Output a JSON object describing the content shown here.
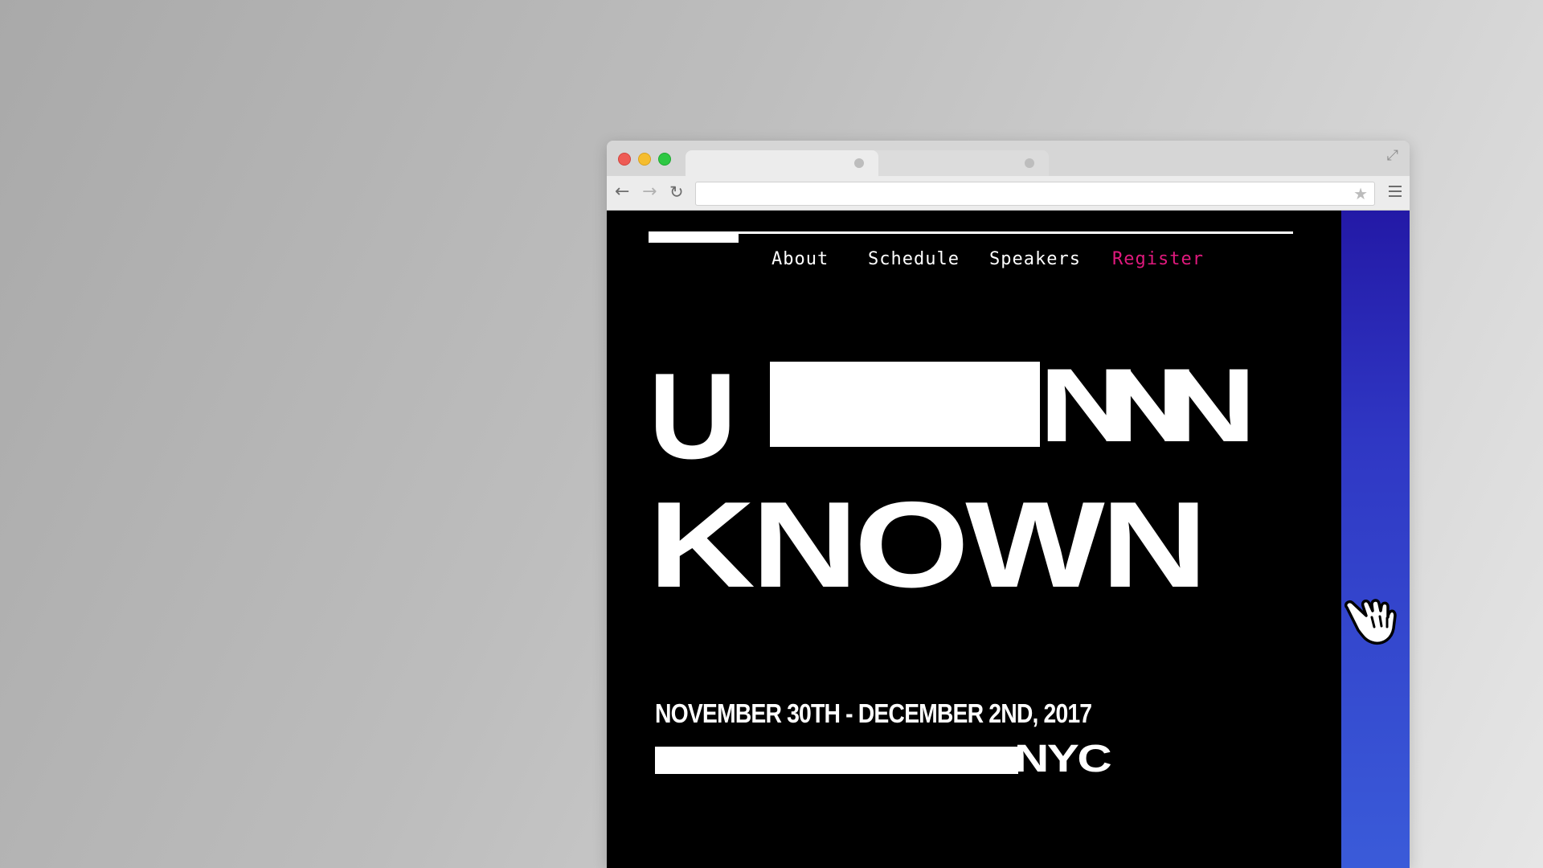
{
  "window": {
    "traffic_lights": [
      "close",
      "minimize",
      "zoom"
    ],
    "address_bar": {
      "value": ""
    }
  },
  "site": {
    "nav": {
      "about": "About",
      "schedule": "Schedule",
      "speakers": "Speakers",
      "register": "Register"
    },
    "hero": {
      "line1_start": "U",
      "line1_end": "NNN",
      "line2": "KNOWN"
    },
    "event": {
      "dates": "NOVEMBER 30TH - DECEMBER 2ND, 2017",
      "city": "NYC"
    },
    "progress": {
      "fraction": 0.14
    }
  },
  "colors": {
    "register_accent": "#e0197d",
    "side_panel_top": "#2319a6",
    "side_panel_bottom": "#3a5bd9",
    "page_background": "#000000"
  },
  "icons": [
    "back-arrow-icon",
    "forward-arrow-icon",
    "reload-icon",
    "bookmark-star-icon",
    "menu-icon",
    "fullscreen-icon",
    "hand-pointer-cursor-icon"
  ]
}
